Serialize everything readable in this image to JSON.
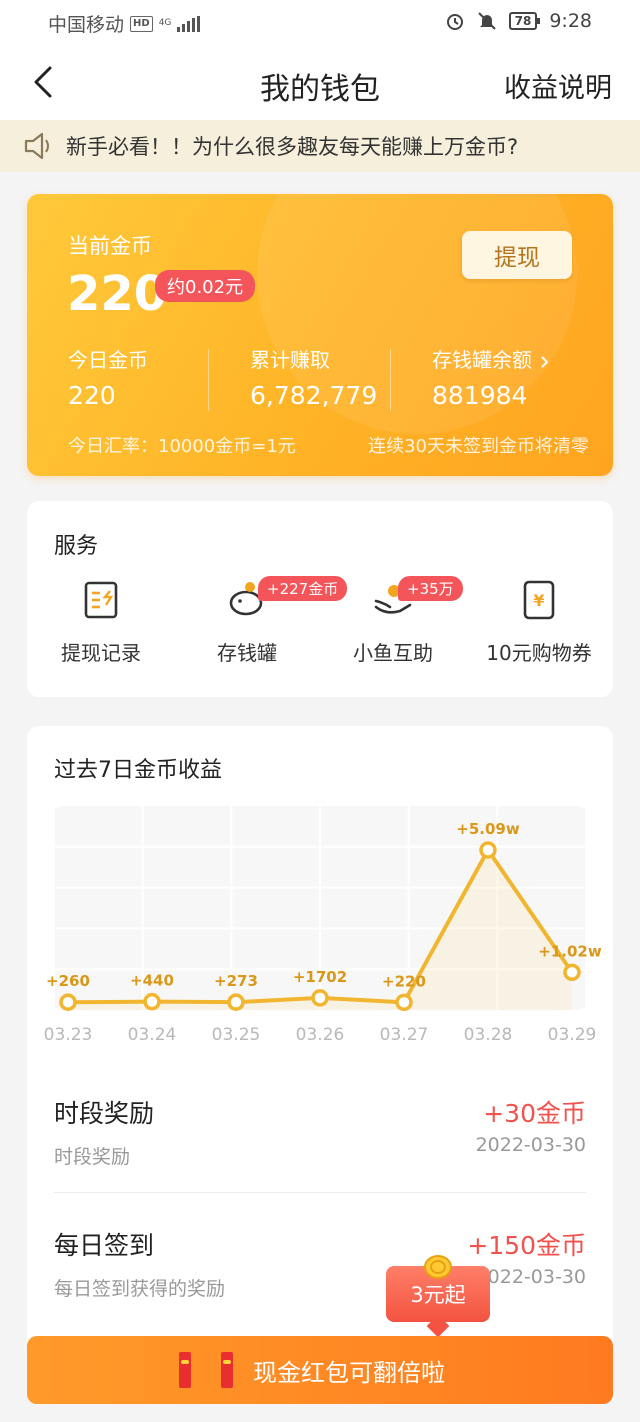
{
  "status_bar": {
    "carrier": "中国移动",
    "hd": "HD",
    "network": "4G",
    "battery": "78",
    "time": "9:28"
  },
  "nav": {
    "title": "我的钱包",
    "help": "收益说明",
    "back_icon": "back-arrow-icon"
  },
  "notice": {
    "text": "新手必看！！为什么很多趣友每天能赚上万金币?"
  },
  "coin_card": {
    "current_label": "当前金币",
    "current_value": "220",
    "cny": "约0.02元",
    "withdraw": "提现",
    "today_label": "今日金币",
    "today_value": "220",
    "total_label": "累计赚取",
    "total_value": "6,782,779",
    "piggy_label": "存钱罐余额",
    "piggy_value": "881984",
    "rate": "今日汇率：10000金币=1元",
    "warning": "连续30天未签到金币将清零"
  },
  "services": {
    "title": "服务",
    "items": [
      {
        "label": "提现记录",
        "icon": "withdraw-record-icon"
      },
      {
        "label": "存钱罐",
        "icon": "piggy-bank-icon",
        "badge": "+227金币"
      },
      {
        "label": "小鱼互助",
        "icon": "fish-hand-icon",
        "badge": "+35万"
      },
      {
        "label": "10元购物券",
        "icon": "coupon-icon"
      }
    ]
  },
  "earnings": {
    "title": "过去7日金币收益"
  },
  "chart_data": {
    "type": "line",
    "categories": [
      "03.23",
      "03.24",
      "03.25",
      "03.26",
      "03.27",
      "03.28",
      "03.29"
    ],
    "values": [
      260,
      440,
      273,
      1702,
      220,
      50900,
      10200
    ],
    "labels": [
      "+260",
      "+440",
      "+273",
      "+1702",
      "+220",
      "+5.09w",
      "+1.02w"
    ],
    "title": "过去7日金币收益",
    "grid": true,
    "color": "#f2b530"
  },
  "rewards": [
    {
      "name": "时段奖励",
      "desc": "时段奖励",
      "amount": "+30金币",
      "date": "2022-03-30"
    },
    {
      "name": "每日签到",
      "desc": "每日签到获得的奖励",
      "amount": "+150金币",
      "date": "2022-03-30"
    }
  ],
  "promo": {
    "text": "3元起"
  },
  "bottom_bar": {
    "text": "现金红包可翻倍啦"
  },
  "colors": {
    "accent": "#ffb326",
    "red": "#f0524e",
    "badge": "#f4555a"
  }
}
